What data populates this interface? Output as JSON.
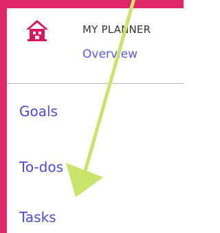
{
  "header": {
    "app_name": "MY PLANNER",
    "overview_link": "Overview",
    "icon": "home-icon",
    "icon_color": "#d8175a"
  },
  "nav": {
    "items": [
      {
        "label": "Goals"
      },
      {
        "label": "To-dos"
      },
      {
        "label": "Tasks"
      }
    ]
  },
  "colors": {
    "frame": "#e0276a",
    "link": "#4a4ad2",
    "annotation_arrow": "#c9e36b"
  }
}
